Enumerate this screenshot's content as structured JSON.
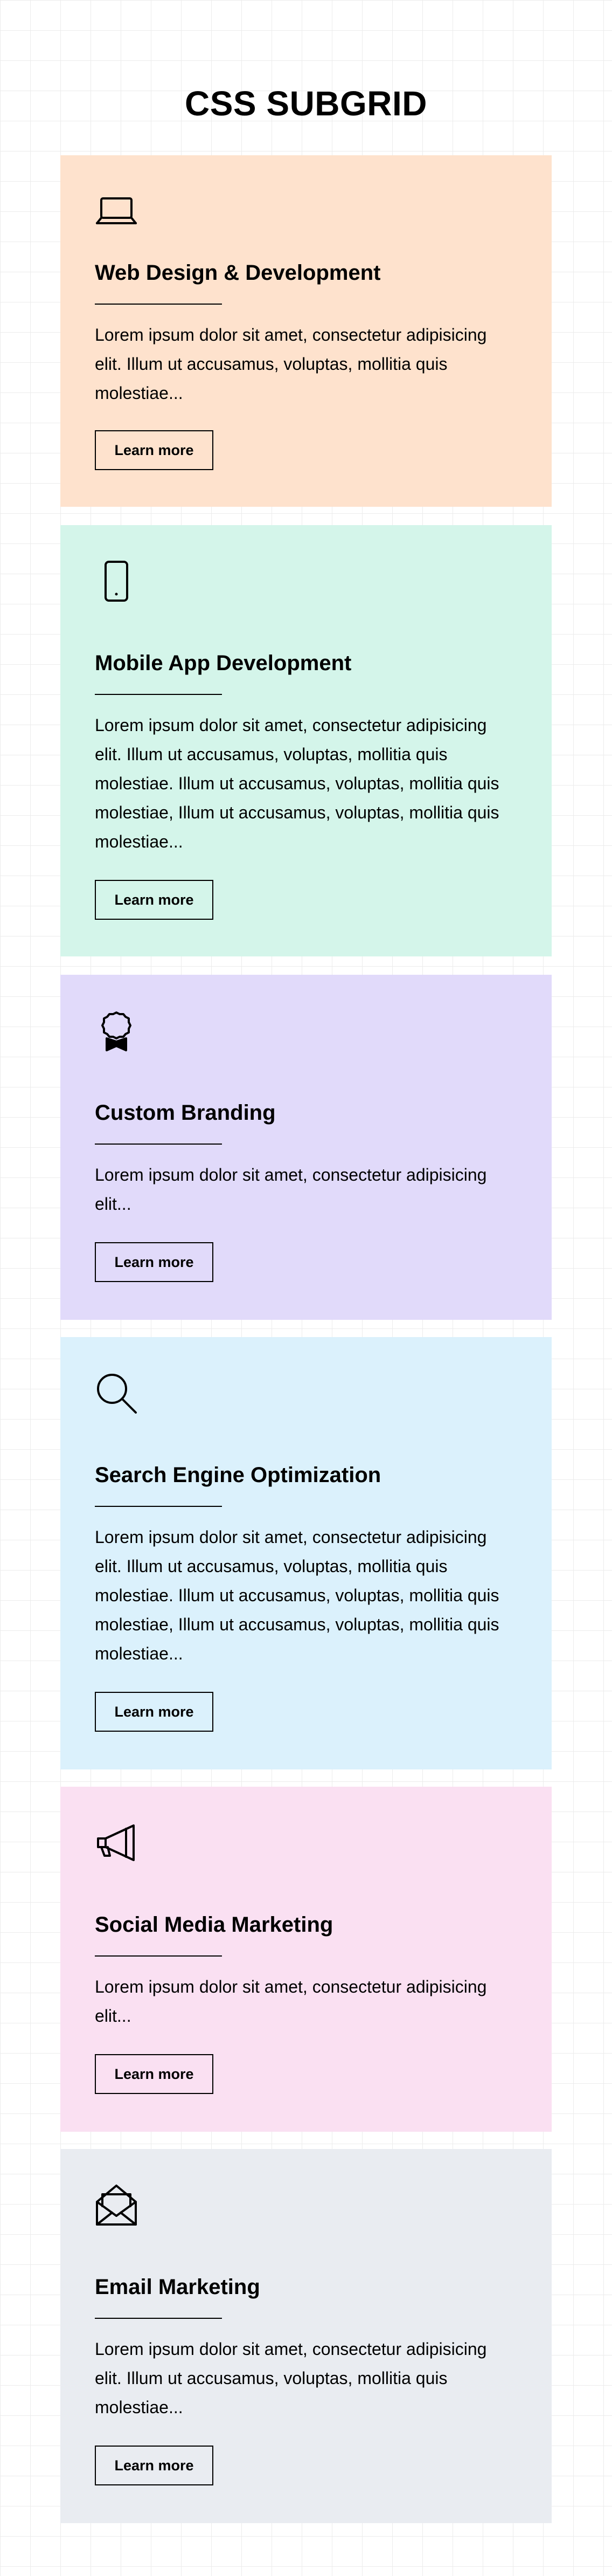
{
  "page": {
    "title": "CSS SUBGRID"
  },
  "cards": [
    {
      "title": "Web Design & Development",
      "text": "Lorem ipsum dolor sit amet, consectetur adipisicing elit. Illum ut accusamus, voluptas, mollitia quis molestiae...",
      "button": "Learn more",
      "icon": "laptop-icon",
      "color": "#fee2cd"
    },
    {
      "title": "Mobile App Development",
      "text": "Lorem ipsum dolor sit amet, consectetur adipisicing elit. Illum ut accusamus, voluptas, mollitia quis molestiae. Illum ut accusamus, voluptas, mollitia quis molestiae, Illum ut accusamus, voluptas, mollitia quis molestiae...",
      "button": "Learn more",
      "icon": "smartphone-icon",
      "color": "#d4f5ea"
    },
    {
      "title": "Custom Branding",
      "text": "Lorem ipsum dolor sit amet, consectetur adipisicing elit...",
      "button": "Learn more",
      "icon": "award-badge-icon",
      "color": "#e1dafa"
    },
    {
      "title": "Search Engine Optimization",
      "text": "Lorem ipsum dolor sit amet, consectetur adipisicing elit. Illum ut accusamus, voluptas, mollitia quis molestiae. Illum ut accusamus, voluptas, mollitia quis molestiae, Illum ut accusamus, voluptas, mollitia quis molestiae...",
      "button": "Learn more",
      "icon": "magnifier-icon",
      "color": "#dbf1fc"
    },
    {
      "title": "Social Media Marketing",
      "text": "Lorem ipsum dolor sit amet, consectetur adipisicing elit...",
      "button": "Learn more",
      "icon": "megaphone-icon",
      "color": "#fae0f2"
    },
    {
      "title": "Email Marketing",
      "text": "Lorem ipsum dolor sit amet, consectetur adipisicing elit. Illum ut accusamus, voluptas, mollitia quis molestiae...",
      "button": "Learn more",
      "icon": "envelope-icon",
      "color": "#e9ecf1"
    }
  ]
}
